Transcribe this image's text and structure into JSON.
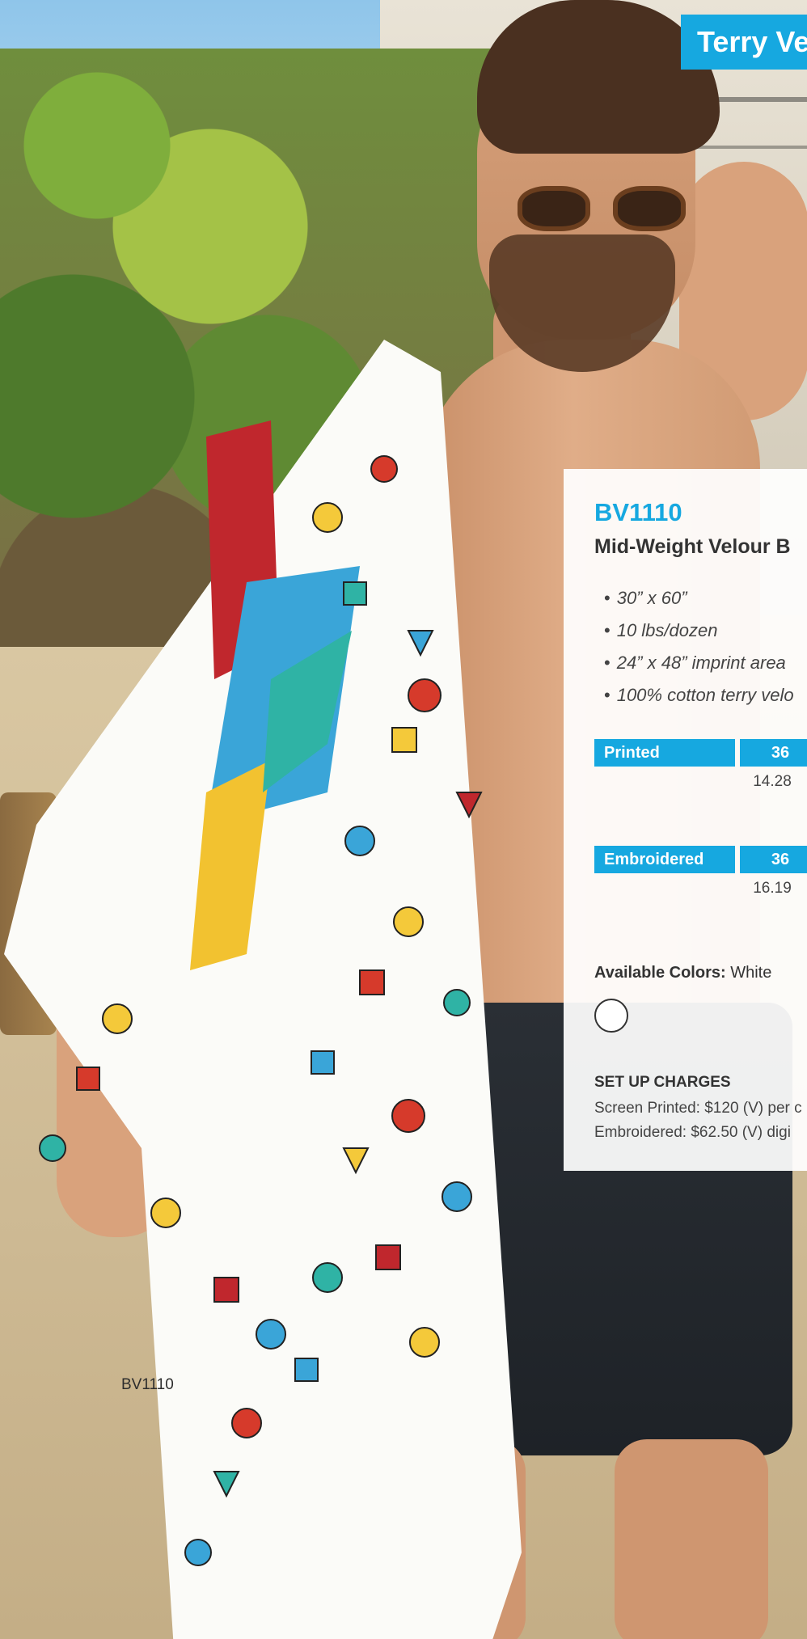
{
  "header": {
    "category_tab": "Terry Ve"
  },
  "product": {
    "sku": "BV1110",
    "name": "Mid-Weight Velour B",
    "specs": [
      "30” x 60”",
      "10 lbs/dozen",
      "24” x 48” imprint area",
      "100% cotton terry velo"
    ]
  },
  "pricing": [
    {
      "method": "Printed",
      "qty": "36",
      "price": "14.28"
    },
    {
      "method": "Embroidered",
      "qty": "36",
      "price": "16.19"
    }
  ],
  "colors": {
    "label": "Available Colors:",
    "value": "White",
    "swatches": [
      "#ffffff"
    ]
  },
  "setup": {
    "title": "SET UP CHARGES",
    "lines": [
      "Screen Printed: $120 (V) per c",
      "Embroidered: $62.50 (V) digi"
    ]
  },
  "photo_label": "BV1110",
  "brand_color": "#16a8e0"
}
